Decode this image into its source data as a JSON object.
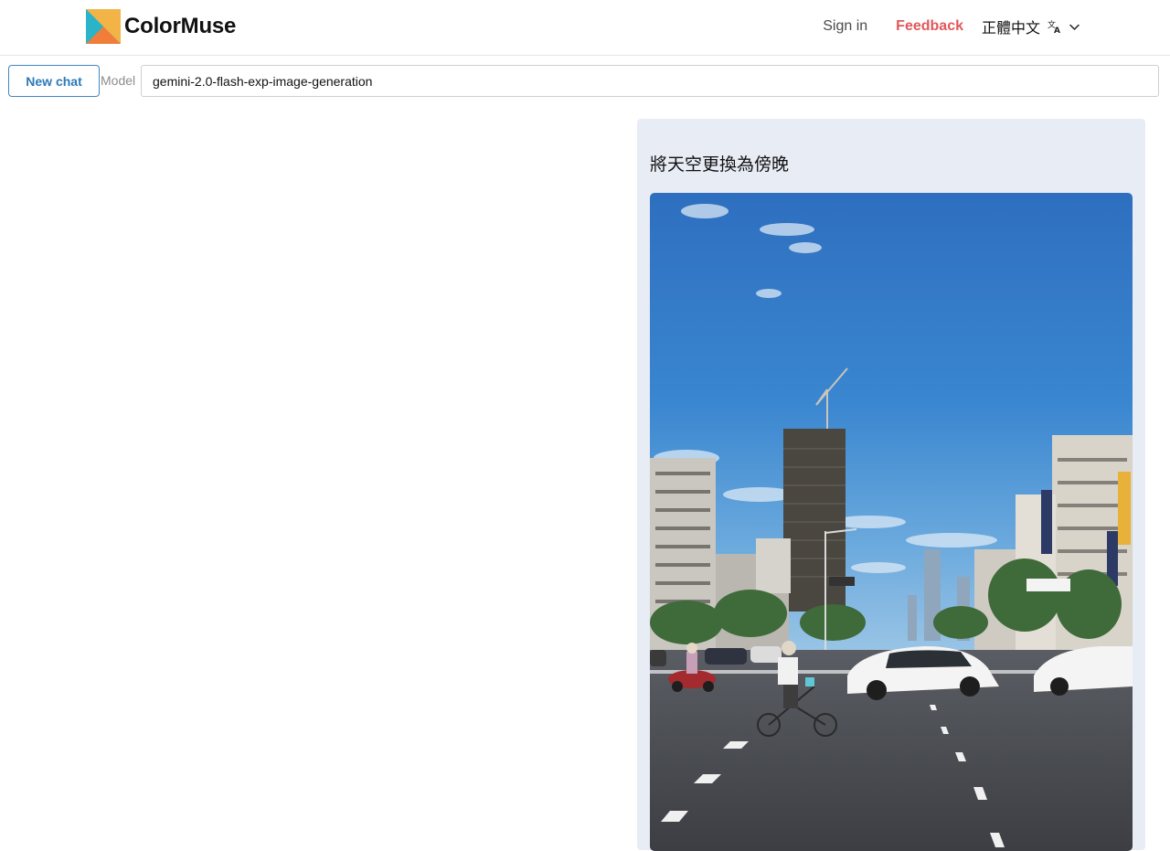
{
  "app": {
    "name": "ColorMuse",
    "brand_colors": [
      "#2aa6cf",
      "#f2b447",
      "#f07e3a",
      "#3f86c2"
    ]
  },
  "header": {
    "signin_label": "Sign in",
    "feedback_label": "Feedback",
    "language_label": "正體中文",
    "language_icon": "translate-icon",
    "dropdown_icon": "chevron-down-icon",
    "feedback_color": "#e0585b"
  },
  "toolbar": {
    "new_chat_label": "New chat",
    "model_label": "Model",
    "model_value": "gemini-2.0-flash-exp-image-generation"
  },
  "chat": {
    "messages": [
      {
        "text": "將天空更換為傍晚",
        "image": "street-scene-photo"
      }
    ]
  }
}
